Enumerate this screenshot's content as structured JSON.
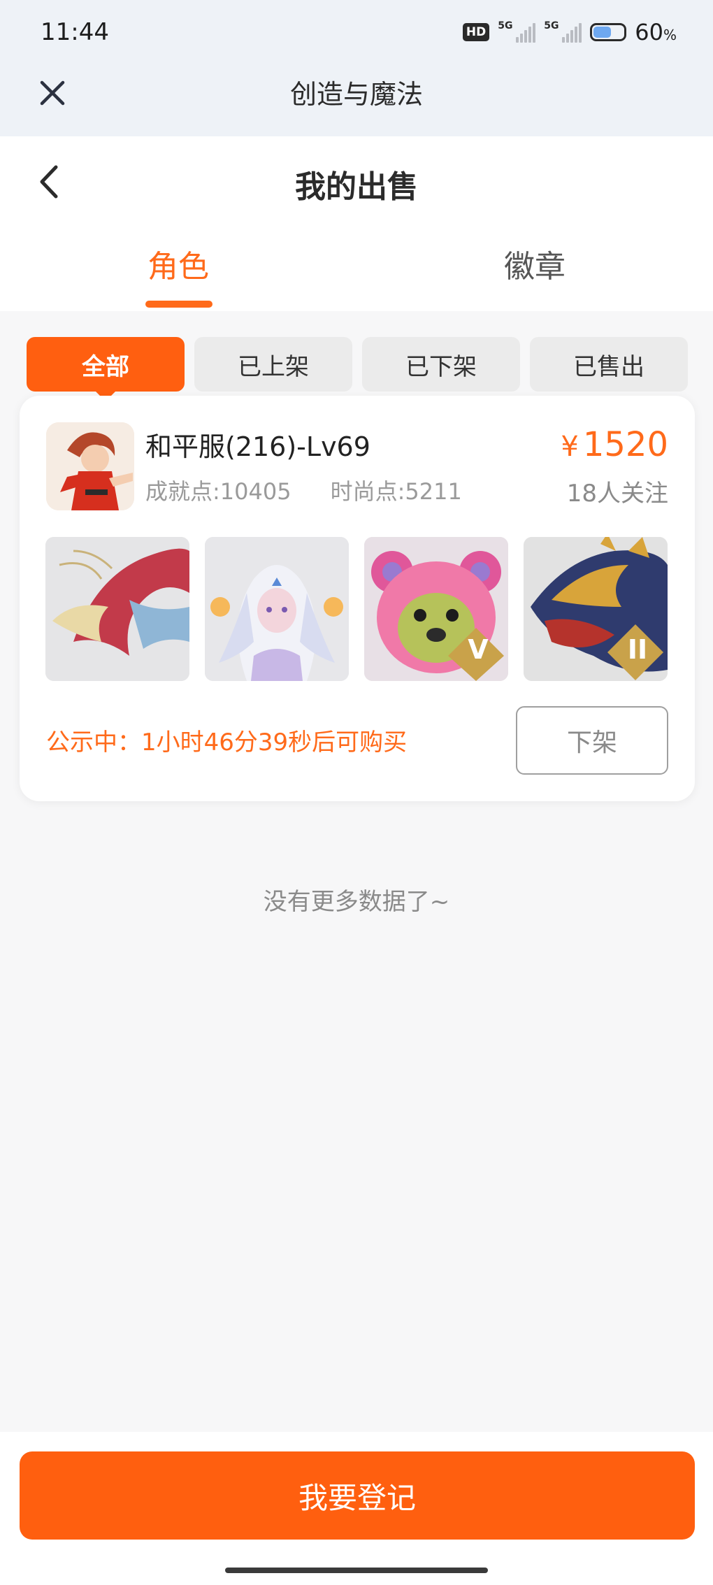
{
  "status_bar": {
    "time": "11:44",
    "hd_label": "HD",
    "network_1": "5G",
    "network_2": "5G",
    "battery_percent": "60",
    "battery_unit": "%",
    "battery_level": 0.6
  },
  "app": {
    "title": "创造与魔法",
    "close_icon": "close-icon"
  },
  "page": {
    "title": "我的出售",
    "back_icon": "chevron-left-icon"
  },
  "tabs": [
    {
      "label": "角色",
      "active": true
    },
    {
      "label": "徽章",
      "active": false
    }
  ],
  "filters": [
    {
      "label": "全部",
      "active": true
    },
    {
      "label": "已上架",
      "active": false
    },
    {
      "label": "已下架",
      "active": false
    },
    {
      "label": "已售出",
      "active": false
    }
  ],
  "listing": {
    "title": "和平服(216)-Lv69",
    "achievement": "成就点:10405",
    "fashion": "时尚点:5211",
    "currency_symbol": "¥",
    "price": "1520",
    "followers": "18人关注",
    "thumbnails": [
      "dragon-red-white",
      "ice-spirit",
      "pink-bear",
      "golden-dragon"
    ],
    "thumbnail_badges": [
      "",
      "",
      "V",
      "II"
    ],
    "notice": "公示中：1小时46分39秒后可购买",
    "delist_label": "下架"
  },
  "footer_text": "没有更多数据了~",
  "register_label": "我要登记",
  "colors": {
    "accent": "#ff6a1a",
    "button": "#ff5f0f",
    "chip_bg": "#ebebeb"
  }
}
